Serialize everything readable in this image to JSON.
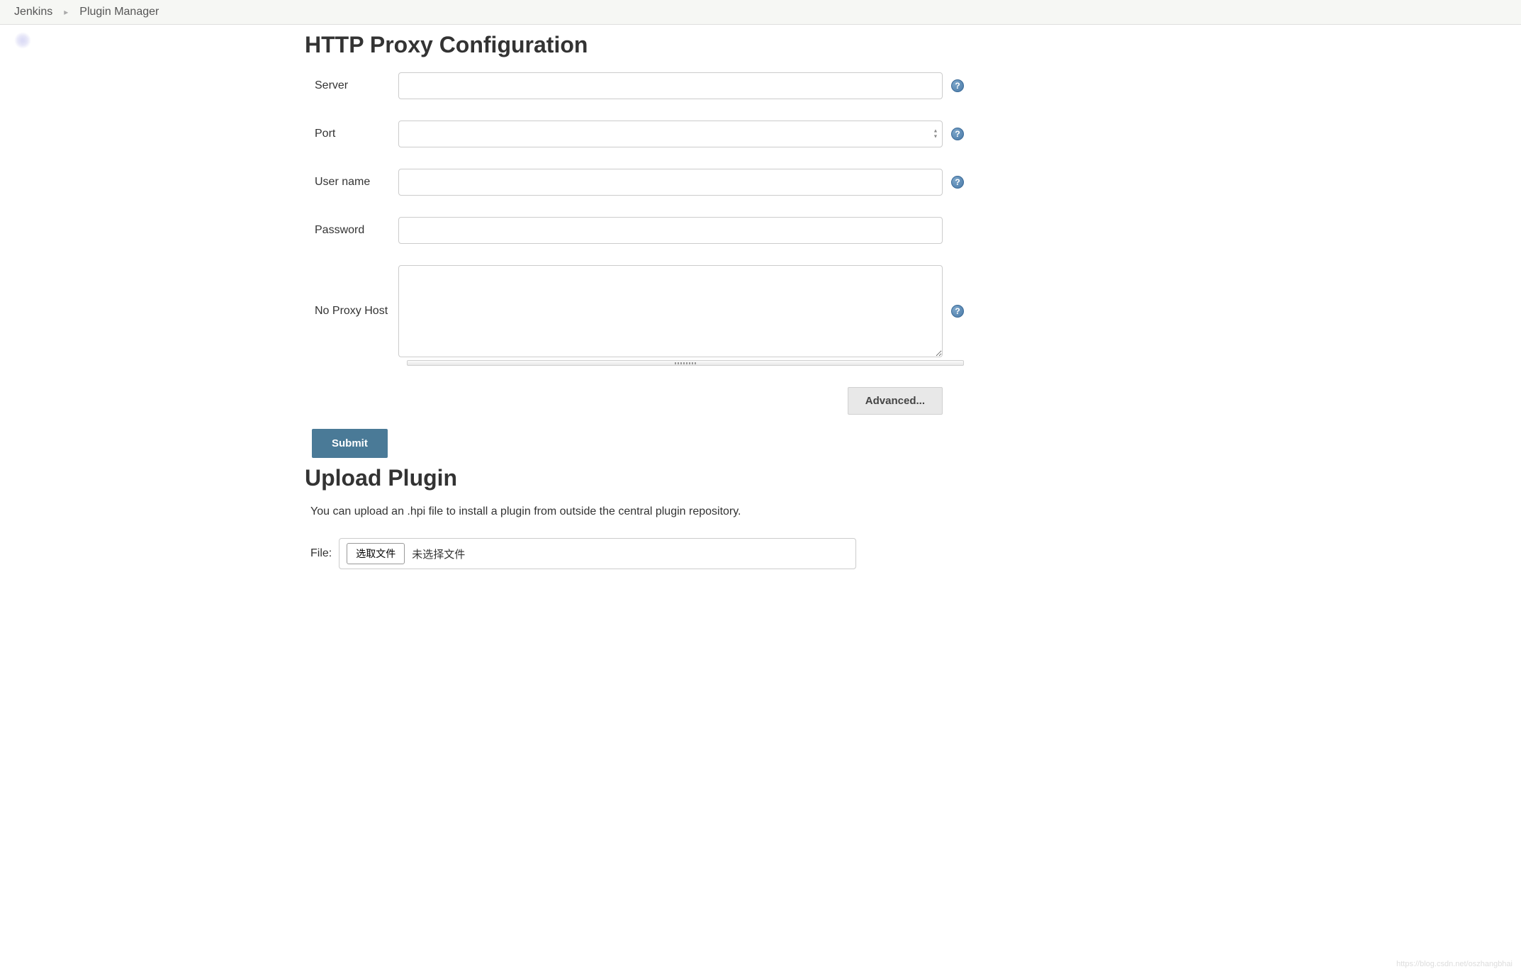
{
  "breadcrumb": {
    "items": [
      "Jenkins",
      "Plugin Manager"
    ]
  },
  "proxy": {
    "heading": "HTTP Proxy Configuration",
    "labels": {
      "server": "Server",
      "port": "Port",
      "username": "User name",
      "password": "Password",
      "noproxy": "No Proxy Host"
    },
    "values": {
      "server": "",
      "port": "",
      "username": "",
      "password": "",
      "noproxy": ""
    },
    "advanced_label": "Advanced...",
    "submit_label": "Submit"
  },
  "upload": {
    "heading": "Upload Plugin",
    "description": "You can upload an .hpi file to install a plugin from outside the central plugin repository.",
    "file_label": "File:",
    "choose_button": "选取文件",
    "no_file": "未选择文件"
  },
  "help_glyph": "?",
  "watermark": "https://blog.csdn.net/oszhangbhai"
}
